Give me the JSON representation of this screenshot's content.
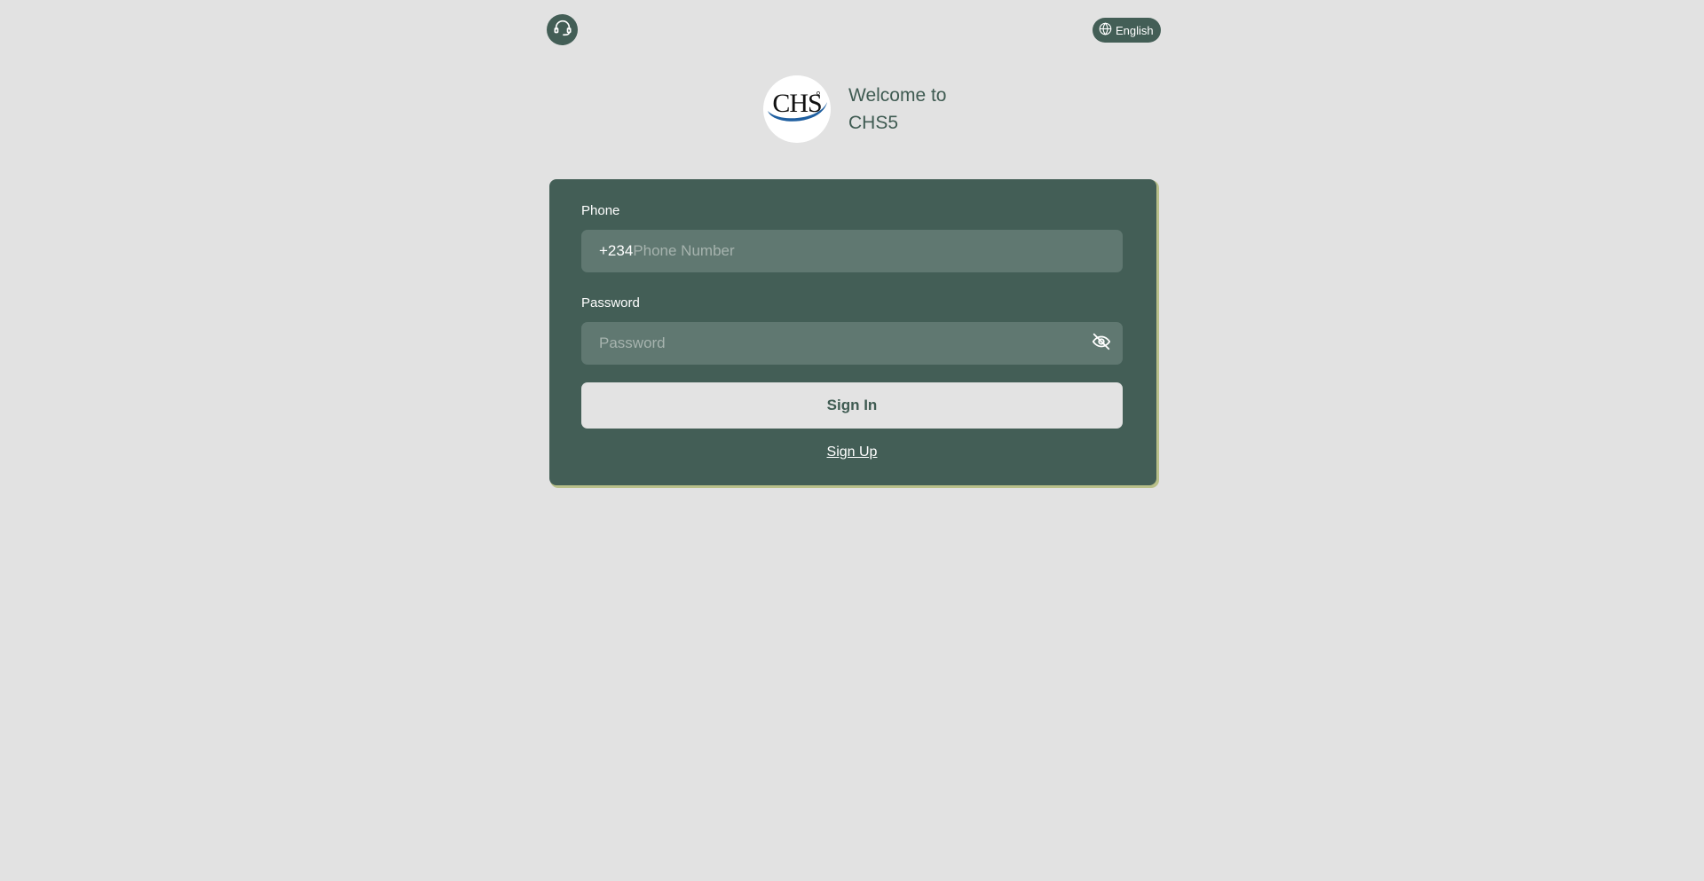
{
  "header": {
    "support_icon": "headset-icon",
    "language": {
      "icon": "globe-icon",
      "label": "English"
    }
  },
  "brand": {
    "logo_text": "CHS",
    "welcome_line1": "Welcome to",
    "welcome_line2": "CHS5"
  },
  "form": {
    "phone": {
      "label": "Phone",
      "prefix": "+234",
      "placeholder": "Phone Number",
      "value": ""
    },
    "password": {
      "label": "Password",
      "placeholder": "Password",
      "value": "",
      "toggle_icon": "eye-off-icon"
    },
    "signin_label": "Sign In",
    "signup_label": "Sign Up"
  },
  "colors": {
    "background": "#e2e2e2",
    "card": "#435e56",
    "input": "#607871",
    "button": "#e3e3e3",
    "accent_shadow": "#b9c08a",
    "logo_blue": "#1f5fa0"
  }
}
